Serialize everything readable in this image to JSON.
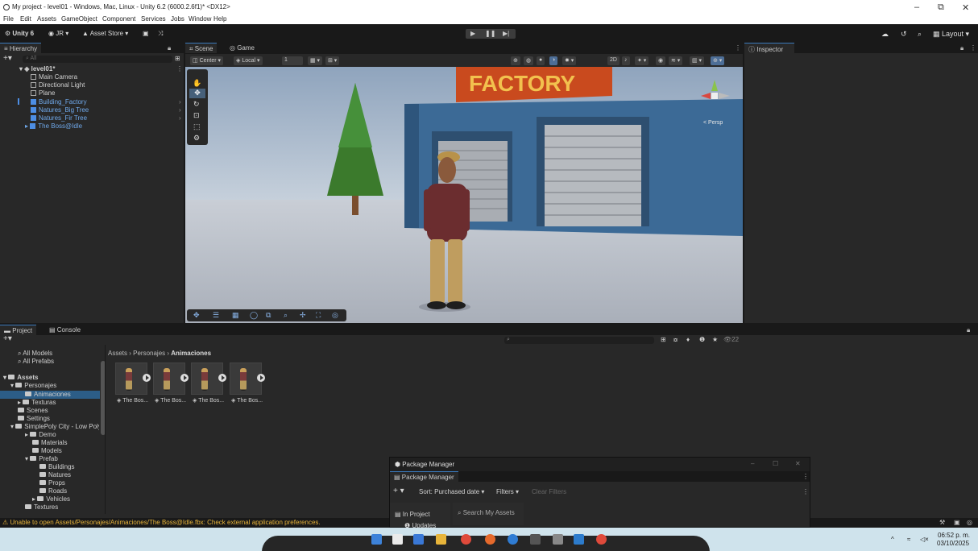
{
  "window": {
    "title": "My project - level01 - Windows, Mac, Linux - Unity 6.2 (6000.2.6f1)* <DX12>",
    "minimize": "–",
    "restore": "⧉",
    "close": "✕"
  },
  "menu": [
    "File",
    "Edit",
    "Assets",
    "GameObject",
    "Component",
    "Services",
    "Jobs",
    "Window",
    "Help"
  ],
  "toolbar": {
    "unity_label": "Unity 6",
    "account": "JR",
    "asset_store": "Asset Store",
    "play": "▶",
    "pause": "❚❚",
    "step": "▶|",
    "layout": "Layout"
  },
  "hierarchy": {
    "tab": "Hierarchy",
    "search_placeholder": "All",
    "scene": "level01*",
    "items": [
      {
        "label": "Main Camera",
        "prefab": false
      },
      {
        "label": "Directional Light",
        "prefab": false
      },
      {
        "label": "Plane",
        "prefab": false
      },
      {
        "label": "Building_Factory",
        "prefab": true
      },
      {
        "label": "Natures_Big Tree",
        "prefab": true
      },
      {
        "label": "Natures_Fir Tree",
        "prefab": true
      },
      {
        "label": "The Boss@Idle",
        "prefab": true
      }
    ]
  },
  "scene": {
    "tab_scene": "Scene",
    "tab_game": "Game",
    "pivot": "Center",
    "space": "Local",
    "grid_value": "1",
    "persp": "< Persp",
    "sign_text": "FACTORY"
  },
  "inspector": {
    "tab": "Inspector"
  },
  "project": {
    "tab_project": "Project",
    "tab_console": "Console",
    "breadcrumb": [
      "Assets",
      "Personajes",
      "Animaciones"
    ],
    "badge_count": "22",
    "tree": [
      {
        "label": "All Models",
        "indent": 1,
        "type": "search"
      },
      {
        "label": "All Prefabs",
        "indent": 1,
        "type": "search"
      },
      {
        "label": "Assets",
        "indent": 0,
        "type": "folder"
      },
      {
        "label": "Personajes",
        "indent": 1,
        "type": "folder"
      },
      {
        "label": "Animaciones",
        "indent": 2,
        "type": "folder"
      },
      {
        "label": "Texturas",
        "indent": 2,
        "type": "folder"
      },
      {
        "label": "Scenes",
        "indent": 1,
        "type": "folder"
      },
      {
        "label": "Settings",
        "indent": 1,
        "type": "folder"
      },
      {
        "label": "SimplePoly City - Low Poly",
        "indent": 1,
        "type": "folder"
      },
      {
        "label": "Demo",
        "indent": 2,
        "type": "folder"
      },
      {
        "label": "Materials",
        "indent": 2,
        "type": "folder"
      },
      {
        "label": "Models",
        "indent": 2,
        "type": "folder"
      },
      {
        "label": "Prefab",
        "indent": 2,
        "type": "folder"
      },
      {
        "label": "Buildings",
        "indent": 3,
        "type": "folder"
      },
      {
        "label": "Natures",
        "indent": 3,
        "type": "folder"
      },
      {
        "label": "Props",
        "indent": 3,
        "type": "folder"
      },
      {
        "label": "Roads",
        "indent": 3,
        "type": "folder"
      },
      {
        "label": "Vehicles",
        "indent": 3,
        "type": "folder"
      },
      {
        "label": "Textures",
        "indent": 2,
        "type": "folder"
      }
    ],
    "assets": [
      "The Bos...",
      "The Bos...",
      "The Bos...",
      "The Bos..."
    ]
  },
  "status": {
    "warning": "Unable to open Assets/Personajes/Animaciones/The Boss@Idle.fbx: Check external application preferences."
  },
  "package_manager": {
    "title": "Package Manager",
    "tab": "Package Manager",
    "sort": "Sort: Purchased date",
    "filters": "Filters",
    "clear_filters": "Clear Filters",
    "in_project": "In Project",
    "updates": "Updates",
    "search_placeholder": "Search My Assets"
  },
  "taskbar": {
    "time": "06:52 p. m.",
    "date": "03/10/2025"
  },
  "colors": {
    "accent": "#3a79bb",
    "prefab_blue": "#6fa8ea",
    "warning": "#e7b43a"
  }
}
